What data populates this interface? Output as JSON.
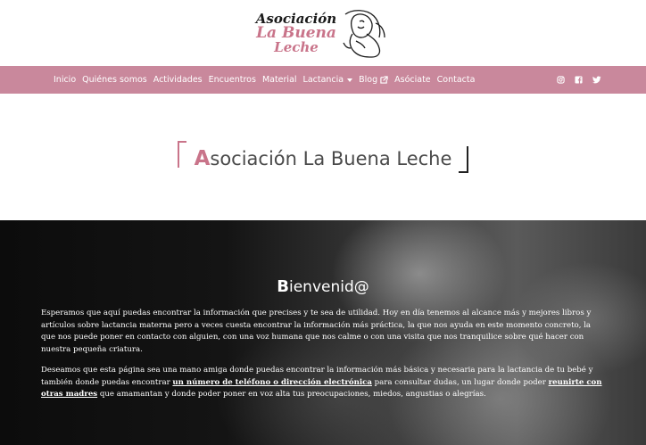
{
  "logo": {
    "line1": "Asociación",
    "line2": "La Buena",
    "line3": "Leche"
  },
  "nav": {
    "items": [
      {
        "label": "Inicio"
      },
      {
        "label": "Quiénes somos"
      },
      {
        "label": "Actividades"
      },
      {
        "label": "Encuentros"
      },
      {
        "label": "Material"
      },
      {
        "label": "Lactancia",
        "dropdown": true
      },
      {
        "label": "Blog",
        "external": true
      },
      {
        "label": "Asóciate"
      },
      {
        "label": "Contacta"
      }
    ],
    "social": [
      "instagram-icon",
      "facebook-icon",
      "twitter-icon"
    ]
  },
  "title": {
    "first_letter": "A",
    "rest": "sociación La Buena Leche"
  },
  "hero": {
    "heading_first": "B",
    "heading_rest": "ienvenid@",
    "p1": "Esperamos que aquí puedas encontrar la información que precises y te sea de utilidad. Hoy en día tenemos al alcance más y mejores libros y artículos sobre lactancia materna pero a veces cuesta encontrar la información más práctica, la que nos ayuda en este momento concreto, la que nos puede poner en contacto con alguien, con una voz humana que nos calme o con una visita que nos tranquilice sobre qué hacer con nuestra pequeña criatura.",
    "p2_a": "Deseamos que esta página sea una mano amiga donde puedas encontrar la información más básica y necesaria para la lactancia de tu bebé y también donde puedas encontrar ",
    "p2_link1": "un número de teléfono o dirección electrónica",
    "p2_b": " para consultar dudas, un lugar donde poder ",
    "p2_link2": "reunirte con otras madres",
    "p2_c": " que amamantan y donde poder poner en voz alta tus preocupaciones, miedos, angustias o alegrías."
  },
  "colors": {
    "brand_pink": "#c9889c",
    "accent_pink": "#c9748a"
  }
}
